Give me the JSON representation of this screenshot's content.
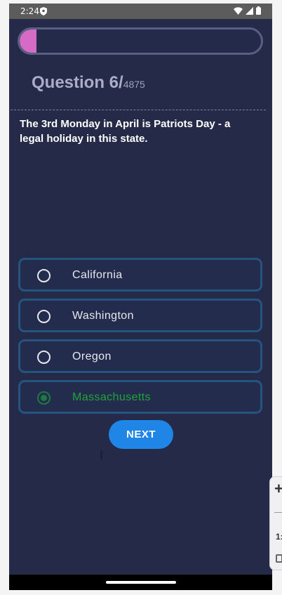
{
  "status_bar": {
    "time": "2:24",
    "icons": [
      "shield-icon",
      "wifi-icon",
      "signal-icon",
      "battery-icon"
    ]
  },
  "progress": {
    "fraction": 0.07,
    "fill_color": "#d66bc7"
  },
  "question": {
    "label": "Question 6/",
    "total": "4875",
    "text": "The 3rd Monday in April is Patriots Day - a legal holiday in this state."
  },
  "options": [
    {
      "label": "California",
      "selected": false
    },
    {
      "label": "Washington",
      "selected": false
    },
    {
      "label": "Oregon",
      "selected": false
    },
    {
      "label": "Massachusetts",
      "selected": true
    }
  ],
  "next_button": {
    "label": "NEXT"
  },
  "floating_widget": {
    "plus": "+",
    "number": "1:"
  },
  "colors": {
    "background": "#252a48",
    "option_border": "#245581",
    "selected_text": "#1ea537",
    "button": "#1f86e8"
  }
}
